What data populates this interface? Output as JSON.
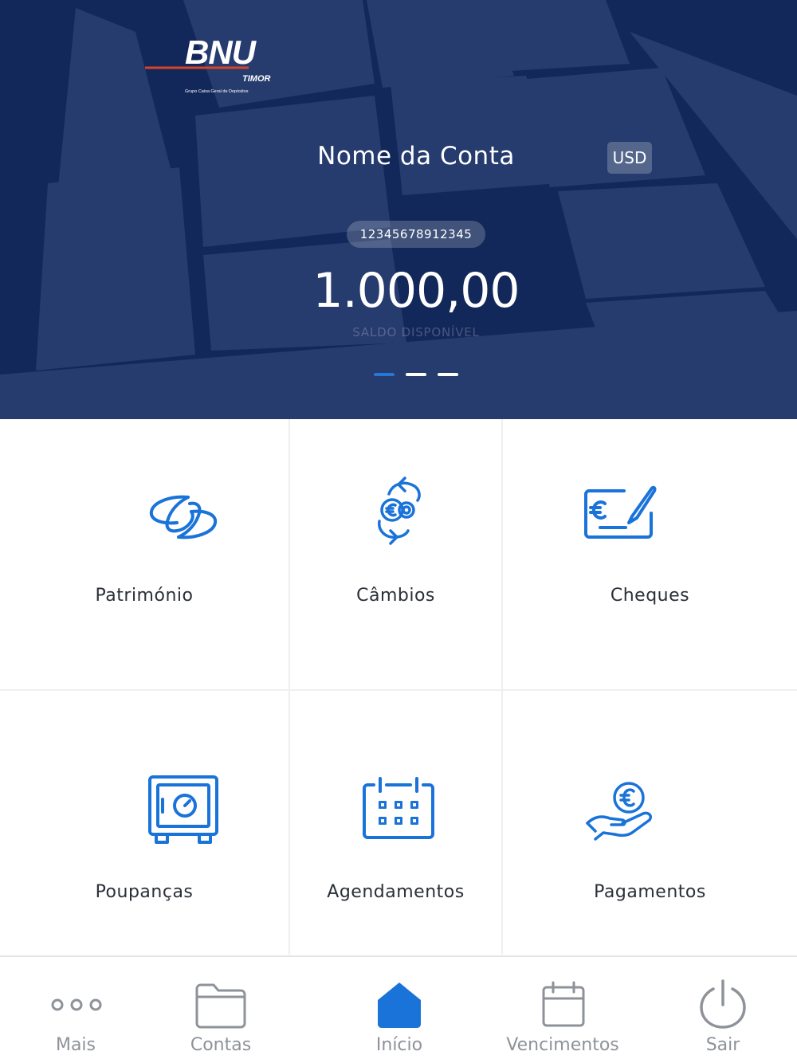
{
  "brand": {
    "logo_text": "BNU",
    "logo_sub": "TIMOR",
    "logo_group": "Grupo Caixa Geral de Depósitos"
  },
  "account": {
    "name": "Nome da Conta",
    "currency": "USD",
    "number": "12345678912345",
    "balance": "1.000,00",
    "balance_label": "SALDO DISPONÍVEL",
    "page_count": 3,
    "active_page": 1
  },
  "menu": [
    {
      "label": "Património",
      "icon": "patrimony-icon"
    },
    {
      "label": "Câmbios",
      "icon": "exchange-icon"
    },
    {
      "label": "Cheques",
      "icon": "cheque-icon"
    },
    {
      "label": "Poupanças",
      "icon": "safe-icon"
    },
    {
      "label": "Agendamentos",
      "icon": "calendar-grid-icon"
    },
    {
      "label": "Pagamentos",
      "icon": "payment-hand-icon"
    }
  ],
  "tabbar": [
    {
      "label": "Mais",
      "icon": "more-dots-icon",
      "active": false
    },
    {
      "label": "Contas",
      "icon": "folder-icon",
      "active": false
    },
    {
      "label": "Início",
      "icon": "home-icon",
      "active": true
    },
    {
      "label": "Vencimentos",
      "icon": "calendar-icon",
      "active": false
    },
    {
      "label": "Sair",
      "icon": "power-icon",
      "active": false
    }
  ],
  "colors": {
    "hero_bg": "#13285a",
    "accent": "#1a73d9",
    "logo_red": "#d8432a",
    "label": "#2b2f38",
    "tab_label": "#8e9299"
  }
}
